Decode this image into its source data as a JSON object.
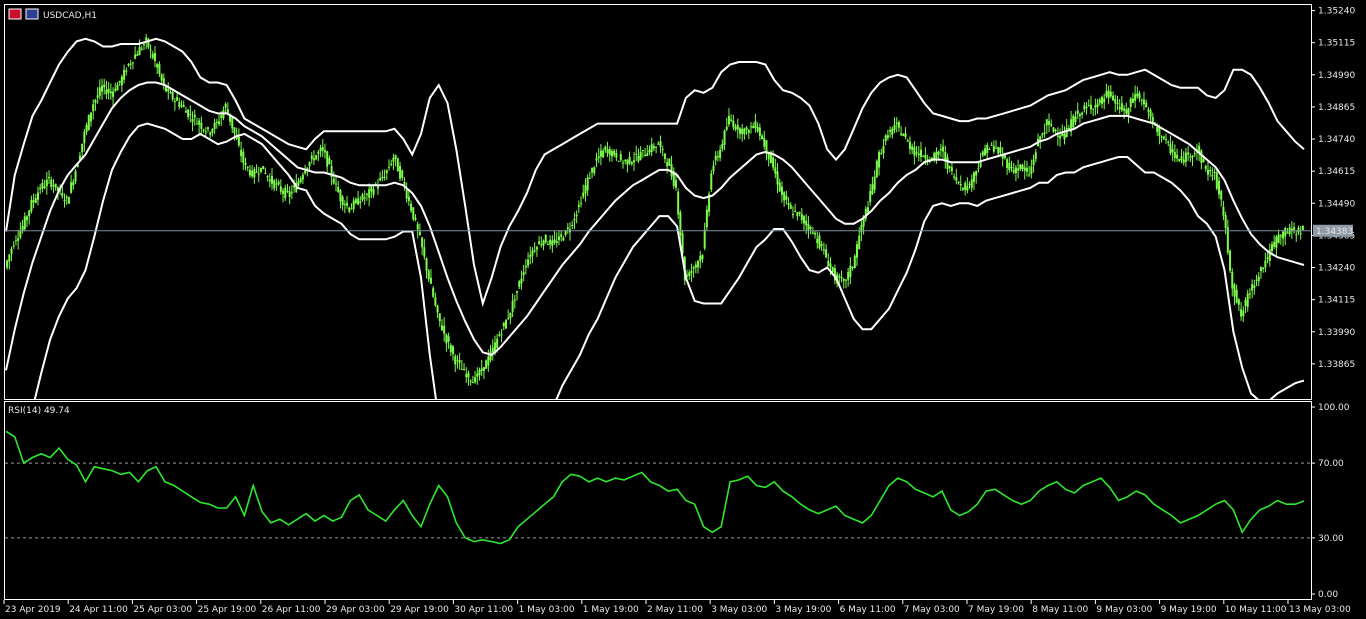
{
  "header": {
    "symbol_label": "USDCAD,H1",
    "flag_left_color": "#c8102e",
    "flag_right_color": "#2c3e8f"
  },
  "colors": {
    "background": "#000000",
    "frame": "#ffffff",
    "candle": "#7cfc4c",
    "bands": "#ffffff",
    "rsi_line": "#2ee82e",
    "level_line": "#9a9a9a",
    "bid_line": "#7f8fa0",
    "bid_label_bg": "#8f9aa6"
  },
  "chart_data": [
    {
      "type": "candlestick",
      "name": "USDCAD,H1",
      "indicator": "Bollinger Bands",
      "ylim": [
        1.3374,
        1.3525
      ],
      "y_ticks": [
        "1.35240",
        "1.35115",
        "1.34990",
        "1.34865",
        "1.34740",
        "1.34615",
        "1.34490",
        "1.34365",
        "1.34240",
        "1.34115",
        "1.33990",
        "1.33865"
      ],
      "y_tick_values": [
        1.3524,
        1.35115,
        1.3499,
        1.34865,
        1.3474,
        1.34615,
        1.3449,
        1.34365,
        1.3424,
        1.34115,
        1.3399,
        1.33865
      ],
      "current_price": 1.34383,
      "current_price_label": "1.34383",
      "x_labels": [
        "23 Apr 2019",
        "24 Apr 11:00",
        "25 Apr 03:00",
        "25 Apr 19:00",
        "26 Apr 11:00",
        "29 Apr 03:00",
        "29 Apr 19:00",
        "30 Apr 11:00",
        "1 May 03:00",
        "1 May 19:00",
        "2 May 11:00",
        "3 May 03:00",
        "3 May 19:00",
        "6 May 11:00",
        "7 May 03:00",
        "7 May 19:00",
        "8 May 11:00",
        "9 May 03:00",
        "9 May 19:00",
        "10 May 11:00",
        "13 May 03:00"
      ],
      "close": [
        1.3424,
        1.3434,
        1.344,
        1.3449,
        1.3455,
        1.3458,
        1.3454,
        1.345,
        1.3462,
        1.3476,
        1.3488,
        1.3494,
        1.3492,
        1.3496,
        1.3503,
        1.3508,
        1.3512,
        1.3504,
        1.3494,
        1.349,
        1.3487,
        1.3483,
        1.348,
        1.3477,
        1.348,
        1.3487,
        1.3476,
        1.3465,
        1.346,
        1.3463,
        1.3458,
        1.3455,
        1.3452,
        1.3456,
        1.3463,
        1.3467,
        1.347,
        1.346,
        1.3451,
        1.3447,
        1.345,
        1.3452,
        1.3456,
        1.346,
        1.3467,
        1.3458,
        1.3447,
        1.3435,
        1.342,
        1.3405,
        1.3396,
        1.3388,
        1.3383,
        1.338,
        1.3384,
        1.339,
        1.3398,
        1.3405,
        1.3415,
        1.3426,
        1.3432,
        1.3435,
        1.3433,
        1.3436,
        1.344,
        1.3448,
        1.3458,
        1.3466,
        1.347,
        1.3468,
        1.3465,
        1.3466,
        1.3468,
        1.347,
        1.3472,
        1.3465,
        1.3455,
        1.342,
        1.3424,
        1.343,
        1.3462,
        1.347,
        1.3482,
        1.3478,
        1.3477,
        1.348,
        1.3472,
        1.3463,
        1.3452,
        1.3446,
        1.3444,
        1.344,
        1.3435,
        1.3428,
        1.342,
        1.3418,
        1.3425,
        1.344,
        1.3452,
        1.3468,
        1.3476,
        1.3479,
        1.3474,
        1.3469,
        1.3468,
        1.3466,
        1.347,
        1.3462,
        1.3457,
        1.3455,
        1.3462,
        1.347,
        1.3471,
        1.3467,
        1.3462,
        1.3463,
        1.346,
        1.3473,
        1.348,
        1.3477,
        1.3475,
        1.3482,
        1.3485,
        1.3487,
        1.3488,
        1.3492,
        1.3487,
        1.3484,
        1.3492,
        1.3488,
        1.348,
        1.3475,
        1.347,
        1.3465,
        1.3468,
        1.347,
        1.3462,
        1.346,
        1.3445,
        1.3417,
        1.3405,
        1.3415,
        1.3422,
        1.3428,
        1.3435,
        1.3438,
        1.3438,
        1.3439
      ],
      "bb_upper": [
        1.3438,
        1.346,
        1.3472,
        1.3483,
        1.3489,
        1.3496,
        1.3503,
        1.3508,
        1.3512,
        1.3513,
        1.3512,
        1.351,
        1.351,
        1.3511,
        1.3511,
        1.3511,
        1.3512,
        1.3513,
        1.3512,
        1.351,
        1.3508,
        1.3504,
        1.3498,
        1.3496,
        1.3496,
        1.3495,
        1.3489,
        1.3482,
        1.348,
        1.3478,
        1.3476,
        1.3474,
        1.3472,
        1.3471,
        1.347,
        1.3474,
        1.3477,
        1.3477,
        1.3477,
        1.3477,
        1.3477,
        1.3477,
        1.3477,
        1.3477,
        1.3478,
        1.3474,
        1.3468,
        1.3476,
        1.349,
        1.3495,
        1.3488,
        1.347,
        1.3448,
        1.3425,
        1.341,
        1.342,
        1.3432,
        1.344,
        1.3446,
        1.3453,
        1.3462,
        1.3468,
        1.347,
        1.3472,
        1.3474,
        1.3476,
        1.3478,
        1.348,
        1.348,
        1.348,
        1.348,
        1.348,
        1.348,
        1.348,
        1.348,
        1.348,
        1.348,
        1.349,
        1.3493,
        1.3492,
        1.3494,
        1.35,
        1.3503,
        1.3504,
        1.3504,
        1.3504,
        1.3503,
        1.3497,
        1.3493,
        1.3492,
        1.349,
        1.3487,
        1.348,
        1.347,
        1.3466,
        1.347,
        1.3478,
        1.3486,
        1.3492,
        1.3496,
        1.3498,
        1.3499,
        1.3498,
        1.3493,
        1.3488,
        1.3484,
        1.3483,
        1.3482,
        1.3481,
        1.3481,
        1.3482,
        1.3482,
        1.3483,
        1.3484,
        1.3485,
        1.3486,
        1.3487,
        1.3489,
        1.3491,
        1.3492,
        1.3493,
        1.3495,
        1.3497,
        1.3498,
        1.3499,
        1.35,
        1.3499,
        1.3499,
        1.35,
        1.3501,
        1.3499,
        1.3497,
        1.3495,
        1.3494,
        1.3494,
        1.3494,
        1.3491,
        1.349,
        1.3493,
        1.3501,
        1.3501,
        1.3499,
        1.3494,
        1.3488,
        1.3481,
        1.3477,
        1.3473,
        1.347
      ],
      "bb_middle": [
        1.3384,
        1.34,
        1.3414,
        1.3426,
        1.3436,
        1.3446,
        1.3454,
        1.346,
        1.3464,
        1.3468,
        1.3474,
        1.348,
        1.3486,
        1.349,
        1.3493,
        1.3495,
        1.3496,
        1.3496,
        1.3495,
        1.3493,
        1.3491,
        1.3489,
        1.3487,
        1.3485,
        1.3484,
        1.3484,
        1.3482,
        1.3479,
        1.3477,
        1.3475,
        1.3472,
        1.3469,
        1.3466,
        1.3463,
        1.3462,
        1.3461,
        1.3461,
        1.346,
        1.3459,
        1.3457,
        1.3456,
        1.3456,
        1.3456,
        1.3456,
        1.3457,
        1.3456,
        1.3453,
        1.3448,
        1.344,
        1.343,
        1.342,
        1.3411,
        1.3403,
        1.3396,
        1.3391,
        1.339,
        1.3393,
        1.3397,
        1.3401,
        1.3405,
        1.341,
        1.3415,
        1.342,
        1.3425,
        1.3429,
        1.3433,
        1.3438,
        1.3442,
        1.3446,
        1.345,
        1.3453,
        1.3456,
        1.3458,
        1.346,
        1.3462,
        1.3462,
        1.346,
        1.3455,
        1.3452,
        1.3451,
        1.3452,
        1.3455,
        1.3459,
        1.3462,
        1.3465,
        1.3468,
        1.3469,
        1.3468,
        1.3466,
        1.3463,
        1.3459,
        1.3455,
        1.3451,
        1.3447,
        1.3443,
        1.3441,
        1.3441,
        1.3443,
        1.3446,
        1.345,
        1.3453,
        1.3457,
        1.346,
        1.3462,
        1.3465,
        1.3466,
        1.3466,
        1.3465,
        1.3465,
        1.3465,
        1.3465,
        1.3466,
        1.3467,
        1.3468,
        1.3469,
        1.347,
        1.3471,
        1.3473,
        1.3474,
        1.3476,
        1.3477,
        1.3478,
        1.348,
        1.3481,
        1.3482,
        1.3483,
        1.3483,
        1.3483,
        1.3482,
        1.3481,
        1.348,
        1.3478,
        1.3476,
        1.3474,
        1.3472,
        1.3469,
        1.3466,
        1.3463,
        1.3458,
        1.345,
        1.3443,
        1.3437,
        1.3433,
        1.343,
        1.3428,
        1.3427,
        1.3426,
        1.3425
      ],
      "bb_lower": [
        1.33,
        1.334,
        1.3356,
        1.3369,
        1.3383,
        1.3396,
        1.3405,
        1.3412,
        1.3416,
        1.3423,
        1.3436,
        1.345,
        1.3462,
        1.3469,
        1.3475,
        1.3479,
        1.348,
        1.3479,
        1.3478,
        1.3476,
        1.3474,
        1.3474,
        1.3476,
        1.3474,
        1.3472,
        1.3473,
        1.3475,
        1.3476,
        1.3474,
        1.3472,
        1.3468,
        1.3464,
        1.346,
        1.3455,
        1.3454,
        1.3448,
        1.3445,
        1.3443,
        1.3441,
        1.3437,
        1.3435,
        1.3435,
        1.3435,
        1.3435,
        1.3436,
        1.3438,
        1.3438,
        1.342,
        1.339,
        1.3365,
        1.3352,
        1.3352,
        1.3358,
        1.3367,
        1.3372,
        1.336,
        1.3354,
        1.3354,
        1.3356,
        1.3357,
        1.3358,
        1.3362,
        1.337,
        1.3378,
        1.3384,
        1.339,
        1.3398,
        1.3404,
        1.3412,
        1.342,
        1.3426,
        1.3432,
        1.3436,
        1.344,
        1.3444,
        1.3444,
        1.344,
        1.342,
        1.3411,
        1.341,
        1.341,
        1.341,
        1.3415,
        1.342,
        1.3426,
        1.3432,
        1.3435,
        1.3439,
        1.3439,
        1.3434,
        1.3428,
        1.3423,
        1.3422,
        1.3424,
        1.342,
        1.3412,
        1.3404,
        1.34,
        1.34,
        1.3404,
        1.3408,
        1.3415,
        1.3422,
        1.3431,
        1.3442,
        1.3448,
        1.3449,
        1.3448,
        1.3449,
        1.3449,
        1.3448,
        1.345,
        1.3451,
        1.3452,
        1.3453,
        1.3454,
        1.3455,
        1.3457,
        1.3457,
        1.346,
        1.3461,
        1.3461,
        1.3463,
        1.3464,
        1.3465,
        1.3466,
        1.3467,
        1.3467,
        1.3464,
        1.3461,
        1.3461,
        1.3459,
        1.3457,
        1.3454,
        1.345,
        1.3444,
        1.3441,
        1.3436,
        1.3423,
        1.3399,
        1.3385,
        1.3375,
        1.3372,
        1.3372,
        1.3375,
        1.3377,
        1.3379,
        1.338
      ]
    },
    {
      "type": "line",
      "name": "RSI(14)",
      "label": "RSI(14) 49.74",
      "ylim": [
        0,
        100
      ],
      "y_ticks": [
        "100.00",
        "70.00",
        "30.00",
        "0.00"
      ],
      "y_tick_values": [
        100,
        70,
        30,
        0
      ],
      "levels": [
        70,
        30
      ],
      "values": [
        87,
        84,
        70,
        73,
        75,
        73,
        78,
        72,
        69,
        60,
        68,
        67,
        66,
        64,
        65,
        60,
        66,
        68,
        60,
        58,
        55,
        52,
        49,
        48,
        46,
        46,
        52,
        42,
        58,
        44,
        38,
        40,
        37,
        40,
        43,
        39,
        42,
        39,
        41,
        50,
        53,
        45,
        42,
        39,
        45,
        50,
        42,
        36,
        48,
        58,
        52,
        38,
        30,
        28,
        29,
        28,
        27,
        29,
        36,
        40,
        44,
        48,
        52,
        60,
        64,
        63,
        60,
        62,
        60,
        62,
        61,
        63,
        65,
        60,
        58,
        55,
        56,
        50,
        48,
        36,
        33,
        36,
        60,
        61,
        63,
        58,
        57,
        60,
        55,
        52,
        48,
        45,
        43,
        45,
        47,
        42,
        40,
        38,
        42,
        50,
        58,
        62,
        60,
        56,
        54,
        52,
        55,
        45,
        42,
        44,
        48,
        55,
        56,
        53,
        50,
        48,
        50,
        55,
        58,
        60,
        56,
        54,
        58,
        60,
        62,
        57,
        50,
        52,
        55,
        53,
        48,
        45,
        42,
        38,
        40,
        42,
        45,
        48,
        50,
        45,
        33,
        40,
        45,
        47,
        50,
        48,
        48,
        49.74
      ]
    }
  ]
}
